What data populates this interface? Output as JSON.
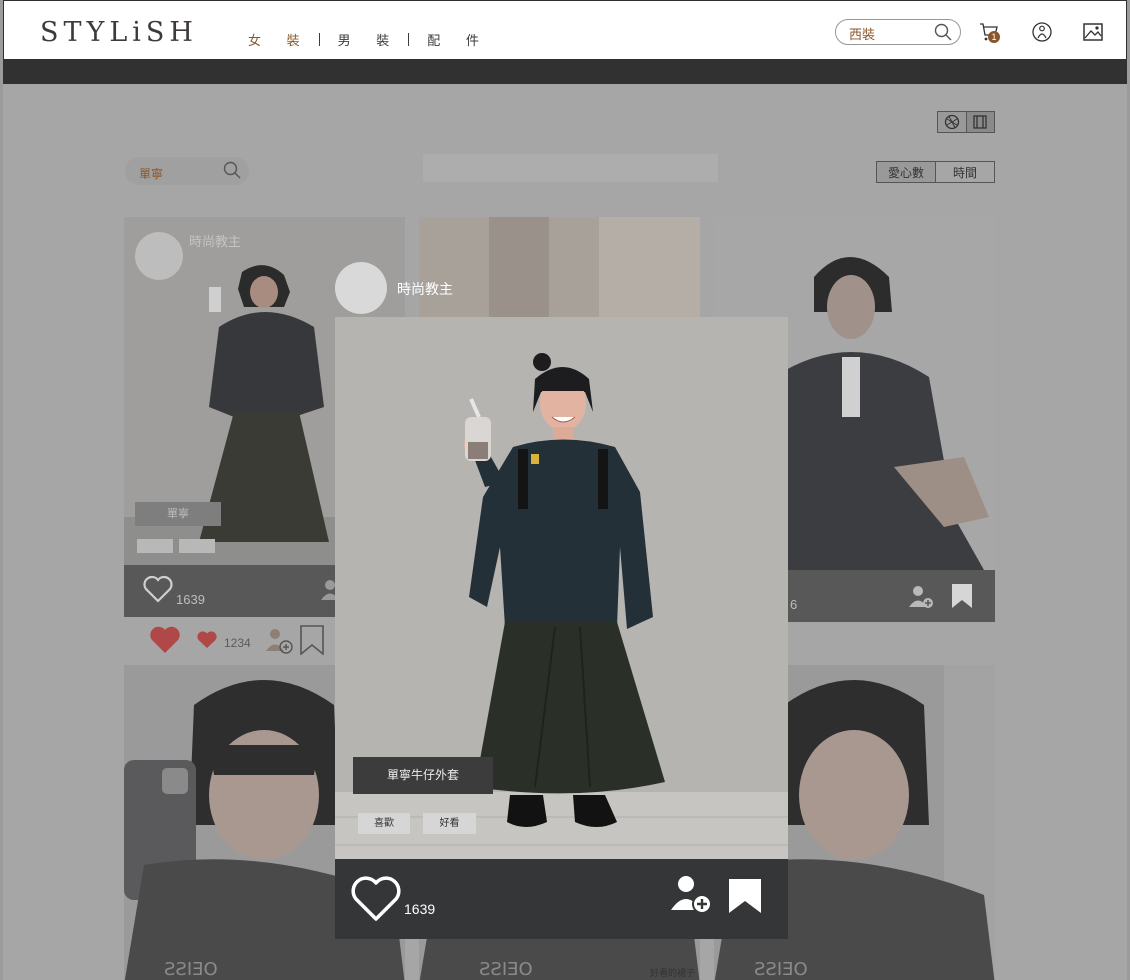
{
  "header": {
    "logo": "STYLiSH",
    "categories": [
      {
        "label": "女 裝",
        "active": true
      },
      {
        "label": "男 裝",
        "active": false
      },
      {
        "label": "配 件",
        "active": false
      }
    ],
    "search_value": "西裝",
    "cart_count": "1",
    "icons": [
      "search-icon",
      "cart-icon",
      "member-icon",
      "image-upload-icon"
    ]
  },
  "filter": {
    "search_value": "單寧",
    "sort_options": [
      "愛心數",
      "時間"
    ]
  },
  "cards": [
    {
      "username": "時尚教主",
      "tag": "單寧",
      "likes": "1639"
    },
    {
      "likes": "6"
    }
  ],
  "reaction_row": {
    "likes": "1234"
  },
  "modal": {
    "username": "時尚教主",
    "tag": "單寧牛仔外套",
    "chips": [
      "喜歡",
      "好看"
    ],
    "likes": "1639"
  },
  "bottom_caption": "好看的裙子",
  "colors": {
    "accent": "#8b572a",
    "modal_bar": "#343638",
    "header_border": "#2f2f2f"
  }
}
